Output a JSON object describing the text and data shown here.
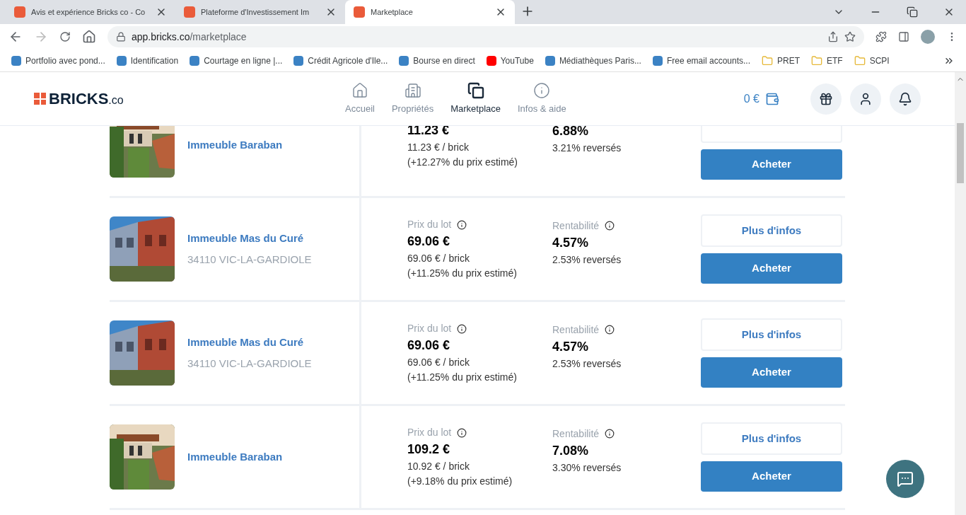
{
  "browser": {
    "tabs": [
      {
        "title": "Avis et expérience Bricks co - Co",
        "selected": false
      },
      {
        "title": "Plateforme d'Investissement Im",
        "selected": false
      },
      {
        "title": "Marketplace",
        "selected": true
      }
    ],
    "url_host": "app.bricks.co",
    "url_path": "/marketplace",
    "bookmarks": [
      "Portfolio avec pond...",
      "Identification",
      "Courtage en ligne |...",
      "Crédit Agricole d'Ile...",
      "Bourse en direct",
      "YouTube",
      "Médiathèques Paris...",
      "Free email accounts...",
      "PRET",
      "ETF",
      "SCPI"
    ]
  },
  "header": {
    "logo": "BRICKS",
    "logo_suffix": ".co",
    "nav": [
      {
        "label": "Accueil",
        "selected": false
      },
      {
        "label": "Propriétés",
        "selected": false
      },
      {
        "label": "Marketplace",
        "selected": true
      },
      {
        "label": "Infos & aide",
        "selected": false
      }
    ],
    "balance": "0 €"
  },
  "listings": [
    {
      "name": "Immeuble Baraban",
      "price": "11.23 €",
      "per_brick": "11.23 € / brick",
      "estimate": "(+12.27% du prix estimé)",
      "yield": "6.88%",
      "paid": "3.21% reversés",
      "buy": "Acheter"
    },
    {
      "name": "Immeuble Mas du Curé",
      "address": "34110 VIC-LA-GARDIOLE",
      "price_label": "Prix du lot",
      "price": "69.06 €",
      "per_brick": "69.06 € / brick",
      "estimate": "(+11.25% du prix estimé)",
      "yield_label": "Rentabilité",
      "yield": "4.57%",
      "paid": "2.53% reversés",
      "more": "Plus d'infos",
      "buy": "Acheter"
    },
    {
      "name": "Immeuble Mas du Curé",
      "address": "34110 VIC-LA-GARDIOLE",
      "price_label": "Prix du lot",
      "price": "69.06 €",
      "per_brick": "69.06 € / brick",
      "estimate": "(+11.25% du prix estimé)",
      "yield_label": "Rentabilité",
      "yield": "4.57%",
      "paid": "2.53% reversés",
      "more": "Plus d'infos",
      "buy": "Acheter"
    },
    {
      "name": "Immeuble Baraban",
      "price_label": "Prix du lot",
      "price": "109.2 €",
      "per_brick": "10.92 € / brick",
      "estimate": "(+9.18% du prix estimé)",
      "yield_label": "Rentabilité",
      "yield": "7.08%",
      "paid": "3.30% reversés",
      "more": "Plus d'infos",
      "buy": "Acheter"
    }
  ]
}
